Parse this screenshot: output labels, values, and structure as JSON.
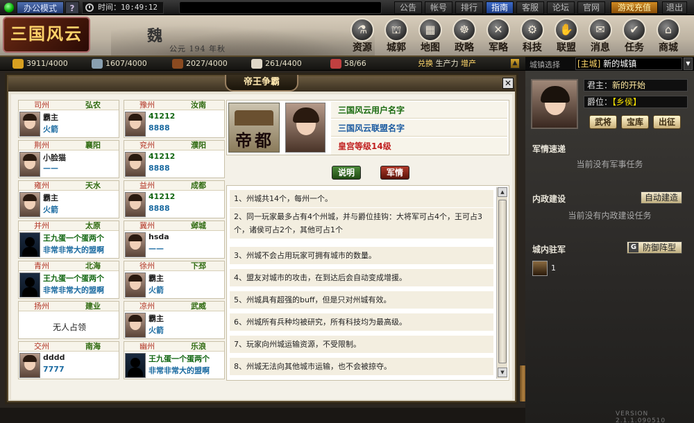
{
  "topbar": {
    "office_mode": "办公模式",
    "help": "?",
    "time_label": "时间：10:49:12",
    "nav": [
      {
        "label": "公告",
        "kind": ""
      },
      {
        "label": "帐号",
        "kind": ""
      },
      {
        "label": "排行",
        "kind": ""
      },
      {
        "label": "指南",
        "kind": "hl"
      },
      {
        "label": "客服",
        "kind": ""
      },
      {
        "label": "论坛",
        "kind": ""
      },
      {
        "label": "官网",
        "kind": ""
      },
      {
        "label": "游戏充值",
        "kind": "gold"
      },
      {
        "label": "退出",
        "kind": ""
      }
    ]
  },
  "banner": {
    "logo_text": "三国风云",
    "logo_pk": "PK",
    "kingdom": "魏",
    "year": "公元 194 年秋",
    "menu": [
      {
        "label": "资源",
        "icon": "resource-icon"
      },
      {
        "label": "城郭",
        "icon": "city-icon"
      },
      {
        "label": "地图",
        "icon": "map-icon"
      },
      {
        "label": "政略",
        "icon": "politics-icon"
      },
      {
        "label": "军略",
        "icon": "military-icon"
      },
      {
        "label": "科技",
        "icon": "tech-icon"
      },
      {
        "label": "联盟",
        "icon": "alliance-icon"
      },
      {
        "label": "消息",
        "icon": "message-icon"
      },
      {
        "label": "任务",
        "icon": "task-icon"
      },
      {
        "label": "商城",
        "icon": "shop-icon"
      }
    ]
  },
  "resources": [
    {
      "value": "3911/4000",
      "color": "#d8a020"
    },
    {
      "value": "1607/4000",
      "color": "#8aa0b0"
    },
    {
      "value": "2027/4000",
      "color": "#8a4a20"
    },
    {
      "value": "261/4400",
      "color": "#e0d8c8"
    },
    {
      "value": "58/66",
      "color": "#c04040"
    }
  ],
  "exchange": {
    "text": "兑换",
    "production": "生产力",
    "increase": "增产"
  },
  "city_select": {
    "label": "城镇选择",
    "prefix": "[主城]",
    "value": "新的城镇"
  },
  "panel": {
    "title": "帝王争霸",
    "states": [
      {
        "prov": "司州",
        "city": "弘农",
        "l1": "霸主",
        "l2": "火箭",
        "ava": "girl",
        "none": ""
      },
      {
        "prov": "豫州",
        "city": "汝南",
        "l1": "41212",
        "l2": "8888",
        "ava": "girl",
        "none": ""
      },
      {
        "prov": "荆州",
        "city": "襄阳",
        "l1": "小脸猫",
        "l2": "——",
        "ava": "girl",
        "none": ""
      },
      {
        "prov": "兖州",
        "city": "濮阳",
        "l1": "41212",
        "l2": "8888",
        "ava": "girl",
        "none": ""
      },
      {
        "prov": "雍州",
        "city": "天水",
        "l1": "霸主",
        "l2": "火箭",
        "ava": "girl",
        "none": ""
      },
      {
        "prov": "益州",
        "city": "成都",
        "l1": "41212",
        "l2": "8888",
        "ava": "girl",
        "none": ""
      },
      {
        "prov": "并州",
        "city": "太原",
        "l1": "王九蛋一个蛋两个",
        "l2": "非常非常大的盟啊",
        "ava": "dark",
        "none": ""
      },
      {
        "prov": "冀州",
        "city": "邺城",
        "l1": "hsda",
        "l2": "——",
        "ava": "girl",
        "none": ""
      },
      {
        "prov": "青州",
        "city": "北海",
        "l1": "王九蛋一个蛋两个",
        "l2": "非常非常大的盟啊",
        "ava": "dark",
        "none": ""
      },
      {
        "prov": "徐州",
        "city": "下邳",
        "l1": "霸主",
        "l2": "火箭",
        "ava": "girl",
        "none": ""
      },
      {
        "prov": "扬州",
        "city": "建业",
        "l1": "",
        "l2": "",
        "ava": "",
        "none": "无人占领"
      },
      {
        "prov": "凉州",
        "city": "武威",
        "l1": "霸主",
        "l2": "火箭",
        "ava": "girl",
        "none": ""
      },
      {
        "prov": "交州",
        "city": "南海",
        "l1": "dddd",
        "l2": "7777",
        "ava": "girl",
        "none": ""
      },
      {
        "prov": "幽州",
        "city": "乐浪",
        "l1": "王九蛋一个蛋两个",
        "l2": "非常非常大的盟啊",
        "ava": "dark",
        "none": ""
      }
    ],
    "capital": {
      "word": "帝都",
      "user_name": "三国风云用户名字",
      "alliance_name": "三国风云联盟名字",
      "palace_level": "皇宫等级14级"
    },
    "explain_button": "说明",
    "military_button": "军情",
    "rules": [
      "1、州城共14个，每州一个。",
      "2、同一玩家最多占有4个州城，并与爵位挂钩：大将军可占4个，王可占3个，诸侯可占2个，其他可占1个",
      "3、州城不会占用玩家可拥有城市的数量。",
      "4、盟友对城市的攻击，在到达后会自动变成增援。",
      "5、州城具有超强的buff，但是只对州城有效。",
      "6、州城所有兵种均被研究，所有科技均为最高级。",
      "7、玩家向州城运输资源，不受限制。",
      "8、州城无法向其他城市运输，也不会被掠夺。"
    ]
  },
  "side": {
    "lord_label": "君主：",
    "lord_value": "新的开始",
    "rank_label": "爵位：",
    "rank_value": "【乡侯】",
    "buttons": [
      "武将",
      "宝库",
      "出征"
    ],
    "military_title": "军情速递",
    "military_empty": "当前没有军事任务",
    "build_title": "内政建设",
    "build_auto": "自动建造",
    "build_empty": "当前没有内政建设任务",
    "garrison_title": "城内驻军",
    "defense_button": "防御阵型",
    "defense_icon_letter": "G",
    "unit_count": "1",
    "version": "VERSION 2.1.1.090510"
  }
}
